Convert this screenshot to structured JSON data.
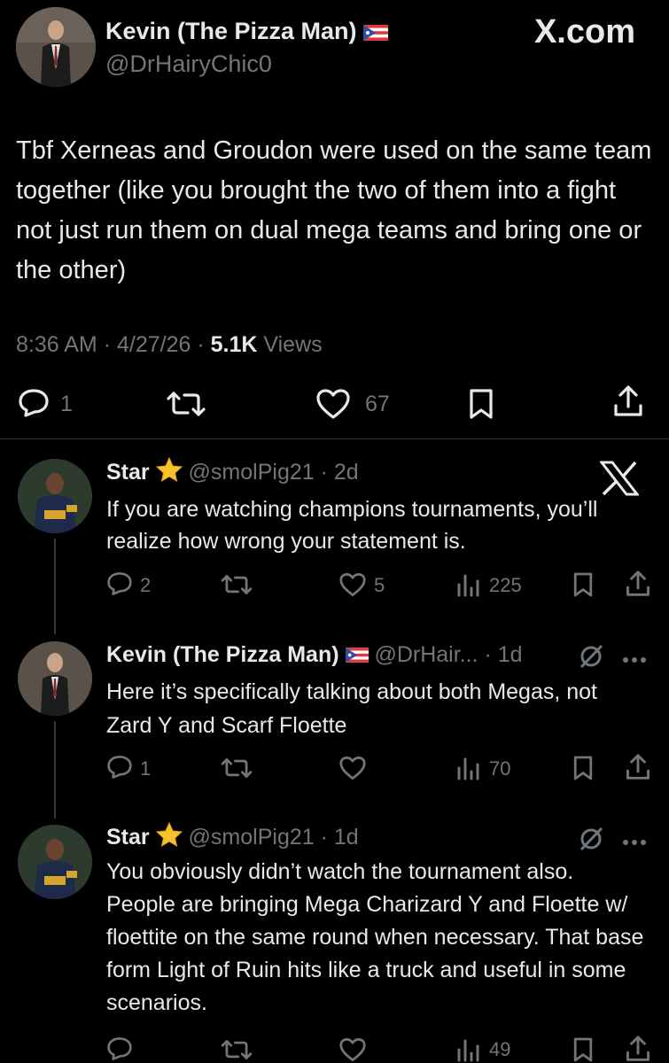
{
  "main_tweet": {
    "author_name": "Kevin (The Pizza Man)",
    "author_handle": "@DrHairyChic0",
    "brand": "X.com",
    "text": "Tbf Xerneas and Groudon were used on the same team together (like you brought the two of them into a fight not just run them on dual mega teams and bring one or the other)",
    "time": "8:36 AM",
    "date": "4/27/26",
    "views_count": "5.1K",
    "views_label": "Views",
    "replies": "1",
    "likes": "67"
  },
  "replies": [
    {
      "author_name": "Star",
      "handle_meta": "@smolPig21 · 2d",
      "text": "If you are watching champions tournaments, you’ll realize how wrong your statement is.",
      "replies": "2",
      "likes": "5",
      "views": "225"
    },
    {
      "author_name": "Kevin (The Pizza Man)",
      "handle_meta": "@DrHair... · 1d",
      "text": "Here it’s specifically talking about both Megas, not Zard Y and Scarf Floette",
      "replies": "1",
      "likes": "",
      "views": "70"
    },
    {
      "author_name": "Star",
      "handle_meta": "@smolPig21 · 1d",
      "text": "You obviously didn’t watch the tournament also. People are bringing  Mega Charizard Y and Floette w/ floettite on the same round when necessary. That base form Light of Ruin hits like a truck and useful in some scenarios.",
      "replies": "",
      "likes": "",
      "views": "49"
    }
  ],
  "colors": {
    "background": "#000000",
    "text": "#e7e9ea",
    "muted": "#71767b",
    "separator": "#2f3336"
  }
}
